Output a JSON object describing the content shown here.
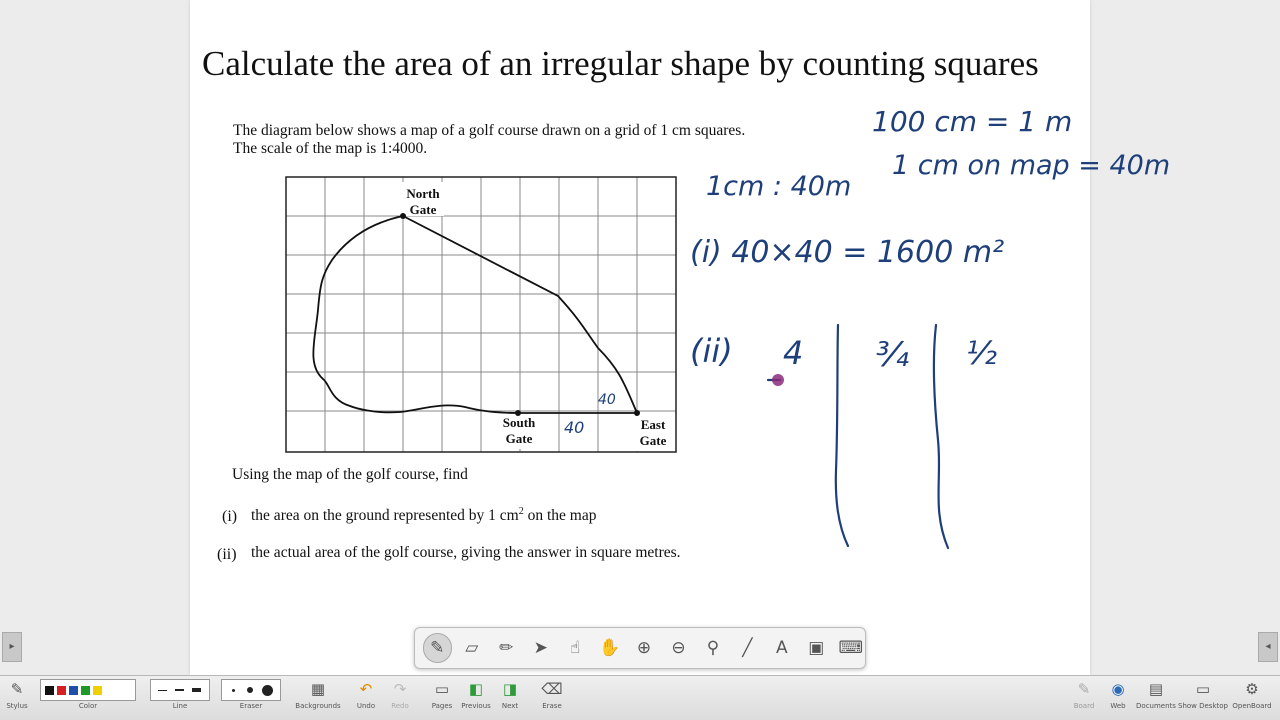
{
  "document": {
    "title": "Calculate the area of an irregular shape by counting squares",
    "intro_line1": "The diagram below shows a map of a golf course drawn on a grid of 1 cm squares.",
    "intro_line2": "The scale of the map is 1:4000.",
    "using": "Using the map of the golf course, find",
    "q1_num": "(i)",
    "q1_text_a": "the area on the ground represented by 1 cm",
    "q1_sup": "2",
    "q1_text_b": " on the map",
    "q2_num": "(ii)",
    "q2_text": "the actual area of the golf course, giving the answer in square metres."
  },
  "map": {
    "north_gate_line1": "North",
    "north_gate_line2": "Gate",
    "south_gate_line1": "South",
    "south_gate_line2": "Gate",
    "east_gate_line1": "East",
    "east_gate_line2": "Gate"
  },
  "handwriting": {
    "line1": "100 cm = 1 m",
    "line2": "1 cm on map = 40m",
    "line3": "1cm : 40m",
    "line4": "(i) 40×40 = 1600 m²",
    "roman2": "(ii)",
    "col1": "4",
    "col2": "¾",
    "col3": "½",
    "map_label_40a": "40",
    "map_label_40b": "40",
    "ink_color": "#1f3f7a"
  },
  "tool_palette": {
    "tools": [
      "pen-icon",
      "eraser-icon",
      "highlighter-icon",
      "pointer-icon",
      "select-hand-icon",
      "pan-hand-icon",
      "zoom-in-icon",
      "zoom-out-icon",
      "laser-pointer-icon",
      "line-icon",
      "text-icon",
      "capture-icon",
      "keyboard-icon"
    ]
  },
  "toolbar": {
    "stylus": "Stylus",
    "color": "Color",
    "line": "Line",
    "eraser": "Eraser",
    "backgrounds": "Backgrounds",
    "undo": "Undo",
    "redo": "Redo",
    "pages": "Pages",
    "previous": "Previous",
    "next": "Next",
    "erase": "Erase",
    "board": "Board",
    "web": "Web",
    "documents": "Documents",
    "show_desktop": "Show Desktop",
    "openboard": "OpenBoard",
    "colors": [
      "#111111",
      "#d42020",
      "#1f4fa8",
      "#1e9a2a",
      "#f0d000"
    ]
  }
}
